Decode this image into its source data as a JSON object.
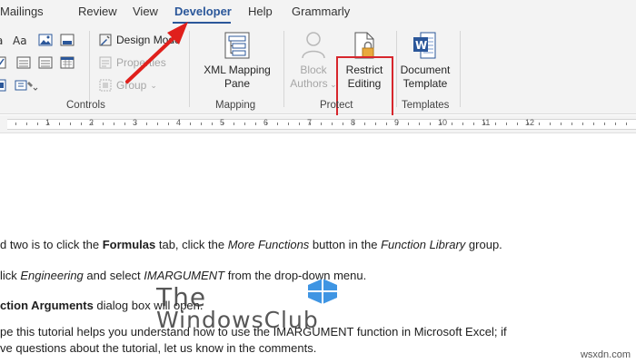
{
  "tabs": [
    {
      "label": "Mailings",
      "active": false
    },
    {
      "label": "Review",
      "active": false
    },
    {
      "label": "View",
      "active": false
    },
    {
      "label": "Developer",
      "active": true
    },
    {
      "label": "Help",
      "active": false
    },
    {
      "label": "Grammarly",
      "active": false
    }
  ],
  "controls": {
    "design_mode": "Design Mode",
    "properties": "Properties",
    "group": "Group",
    "label": "Controls"
  },
  "mapping": {
    "xml_line1": "XML Mapping",
    "xml_line2": "Pane",
    "label": "Mapping"
  },
  "protect": {
    "block_line1": "Block",
    "block_line2": "Authors",
    "restrict_line1": "Restrict",
    "restrict_line2": "Editing",
    "label": "Protect"
  },
  "templates": {
    "doc_line1": "Document",
    "doc_line2": "Template",
    "label": "Templates"
  },
  "ruler_numbers": [
    "1",
    "2",
    "3",
    "4",
    "5",
    "6",
    "7",
    "8",
    "9",
    "10",
    "11",
    "12"
  ],
  "document": {
    "p1": {
      "t1": "d two is to click the ",
      "b1": "Formulas",
      "t2": " tab, click the ",
      "i1": "More Functions",
      "t3": " button in the ",
      "i2": "Function Library",
      "t4": " group."
    },
    "p2": {
      "t1": "lick ",
      "i1": "Engineering",
      "t2": " and select ",
      "i2": "IMARGUMENT",
      "t3": " from the drop-down menu."
    },
    "p3": {
      "b1": "ction Arguments",
      "t1": " dialog box will open."
    },
    "p4": "pe this tutorial helps you understand how to use the IMARGUMENT function in Microsoft Excel; if",
    "p5": "ve questions about the tutorial, let us know in the comments."
  },
  "watermark": {
    "line1": "The",
    "line2": "WindowsClub"
  },
  "credit": "wsxdn.com",
  "colors": {
    "accent": "#2b579a",
    "highlight": "#d7262c",
    "arrow": "#e0201c",
    "ribbon_bg": "#f3f3f3"
  }
}
